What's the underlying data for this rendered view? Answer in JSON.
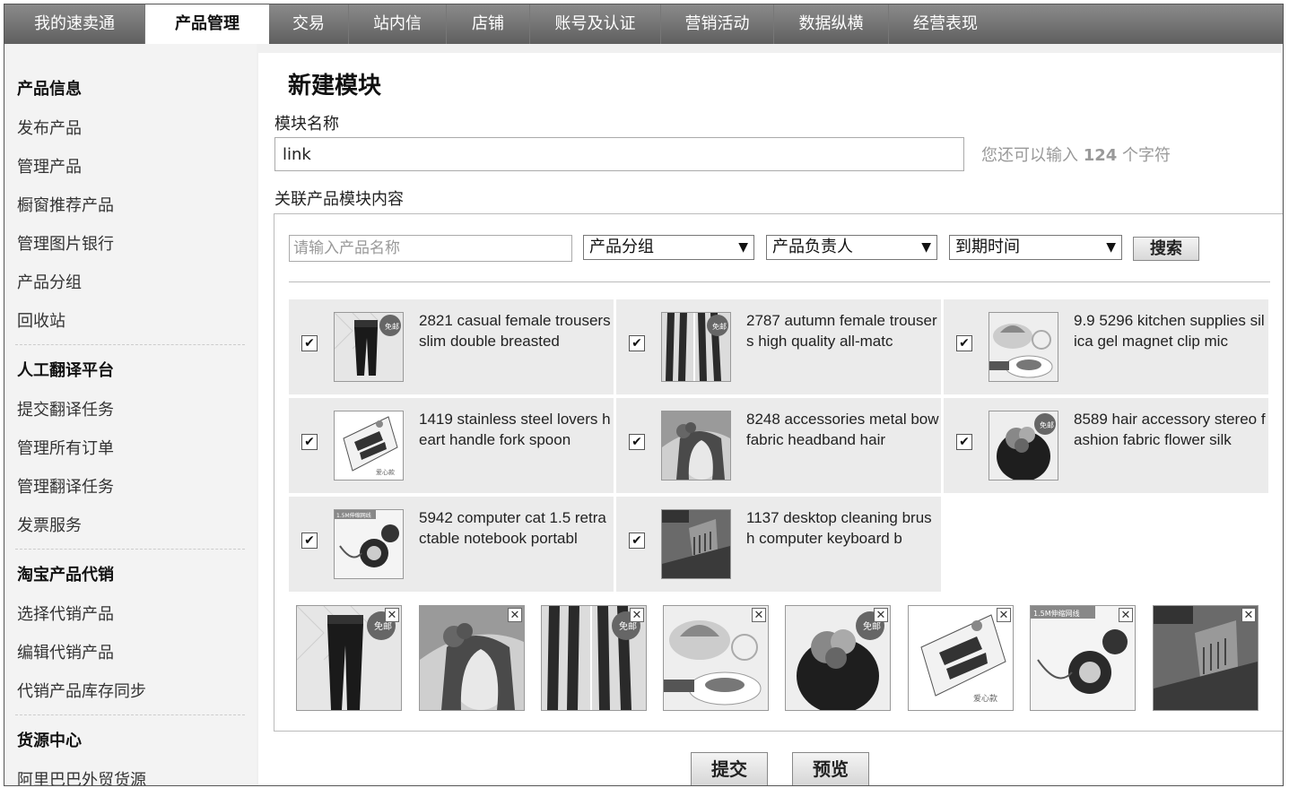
{
  "topnav": {
    "tabs": [
      "我的速卖通",
      "产品管理",
      "交易",
      "站内信",
      "店铺",
      "账号及认证",
      "营销活动",
      "数据纵横",
      "经营表现"
    ]
  },
  "sidebar": {
    "groups": [
      {
        "title": "产品信息",
        "items": [
          "发布产品",
          "管理产品",
          "橱窗推荐产品",
          "管理图片银行",
          "产品分组",
          "回收站"
        ]
      },
      {
        "title": "人工翻译平台",
        "items": [
          "提交翻译任务",
          "管理所有订单",
          "管理翻译任务",
          "发票服务"
        ]
      },
      {
        "title": "淘宝产品代销",
        "items": [
          "选择代销产品",
          "编辑代销产品",
          "代销产品库存同步"
        ]
      },
      {
        "title": "货源中心",
        "items": [
          "阿里巴巴外贸货源"
        ]
      }
    ]
  },
  "main": {
    "title": "新建模块",
    "name_label": "模块名称",
    "name_value": "link",
    "hint_prefix": "您还可以输入",
    "hint_count": "124",
    "hint_suffix": "个字符",
    "related_label": "关联产品模块内容",
    "search_placeholder": "请输入产品名称",
    "select_group": "产品分组",
    "select_owner": "产品负责人",
    "select_expire": "到期时间",
    "search_button": "搜索",
    "products": [
      {
        "text": "2821 casual female trousers slim double breasted",
        "thumb": "trousers"
      },
      {
        "text": "2787 autumn female trousers high quality all-matc",
        "thumb": "legs"
      },
      {
        "text": "9.9 5296 kitchen supplies silica gel magnet clip mic",
        "thumb": "clip"
      },
      {
        "text": "1419 stainless steel lovers heart handle fork spoon",
        "thumb": "spoon"
      },
      {
        "text": "8248 accessories metal bow fabric headband hair",
        "thumb": "girl"
      },
      {
        "text": "8589 hair accessory stereo fashion fabric flower silk",
        "thumb": "flower"
      },
      {
        "text": "5942 computer cat 1.5 retractable notebook portabl",
        "thumb": "cable"
      },
      {
        "text": "1137 desktop cleaning brush computer keyboard b",
        "thumb": "brush"
      }
    ],
    "badge_free": "免邮",
    "badge_cable": "1.5M伸缩网线",
    "badge_love": "爱心款",
    "close_glyph": "✕",
    "check_glyph": "✔",
    "submit_button": "提交",
    "preview_button": "预览"
  },
  "colors": {
    "nav_dark": "#5f5f5f",
    "nav_light": "#8a8a8a",
    "card_bg": "#ebebeb",
    "sidebar_bg": "#f3f3f3"
  }
}
